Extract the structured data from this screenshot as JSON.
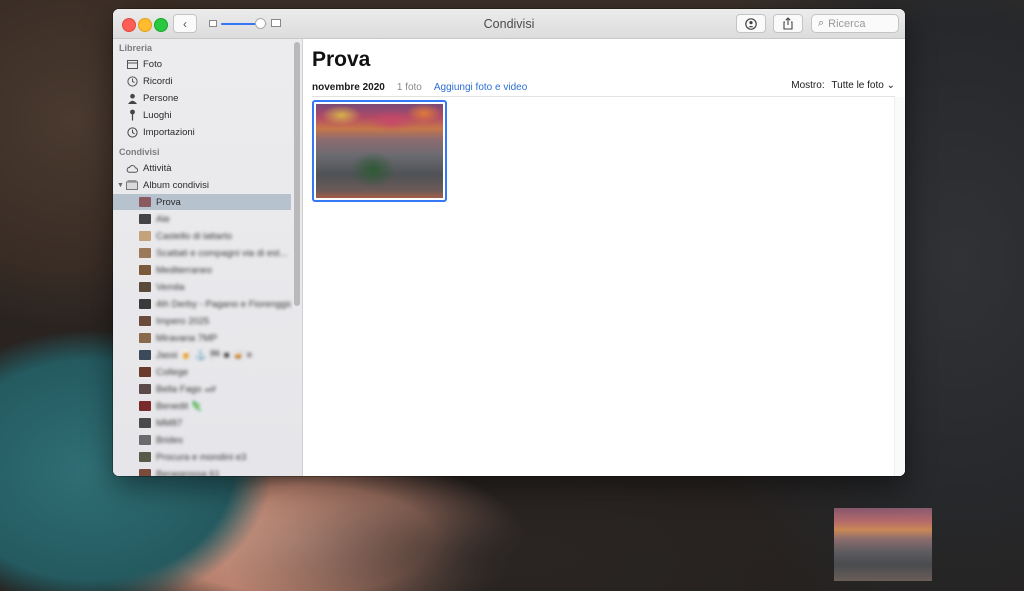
{
  "window": {
    "title": "Condivisi"
  },
  "toolbar": {
    "back_glyph": "‹",
    "people_icon": "person-circle-icon",
    "share_icon": "share-icon",
    "search_placeholder": "Ricerca",
    "zoom_level": 0.85
  },
  "sidebar": {
    "library_header": "Libreria",
    "library_items": [
      {
        "label": "Foto",
        "icon": "photos-icon"
      },
      {
        "label": "Ricordi",
        "icon": "memories-icon"
      },
      {
        "label": "Persone",
        "icon": "person-icon"
      },
      {
        "label": "Luoghi",
        "icon": "pin-icon"
      },
      {
        "label": "Importazioni",
        "icon": "clock-icon"
      }
    ],
    "shared_header": "Condivisi",
    "activity": {
      "label": "Attività",
      "icon": "cloud-icon"
    },
    "albums_group": {
      "label": "Album condivisi",
      "icon": "albums-icon"
    },
    "albums": [
      {
        "label": "Prova",
        "selected": true,
        "color": "#8a5a60"
      },
      {
        "label": "Ale",
        "blurred": true,
        "color": "#444444"
      },
      {
        "label": "Castello di lattarto",
        "blurred": true,
        "color": "#c4a27a"
      },
      {
        "label": "Scattati e compagni via di est...",
        "blurred": true,
        "color": "#9a7a5a"
      },
      {
        "label": "Mediterraneo",
        "blurred": true,
        "color": "#7a5a3a"
      },
      {
        "label": "Vemila",
        "blurred": true,
        "color": "#5a4a3a"
      },
      {
        "label": "4th Derby - Pagano e Fiorenggio",
        "blurred": true,
        "color": "#3a3a3a"
      },
      {
        "label": "Impero 2025",
        "blurred": true,
        "color": "#6a4a3a"
      },
      {
        "label": "Miravana 7MP",
        "blurred": true,
        "color": "#8a6a4a"
      },
      {
        "label": "Jassi 🍺 ⚓ 🏁 ■ 🥃 ≡",
        "blurred": true,
        "color": "#3a4a5a"
      },
      {
        "label": "College",
        "blurred": true,
        "color": "#6a3a2a"
      },
      {
        "label": "Bella Fago 🏎",
        "blurred": true,
        "color": "#5a4a4a"
      },
      {
        "label": "Benedit 🦎",
        "blurred": true,
        "color": "#7a2a2a"
      },
      {
        "label": "MM87",
        "blurred": true,
        "color": "#4a4a4a"
      },
      {
        "label": "Brides",
        "blurred": true,
        "color": "#6a6a6a"
      },
      {
        "label": "Procura e mondini e3",
        "blurred": true,
        "color": "#5a5a4a"
      },
      {
        "label": "Benegrossa 61",
        "blurred": true,
        "color": "#7a4a3a"
      }
    ]
  },
  "main": {
    "album_title": "Prova",
    "date": "novembre 2020",
    "count": "1 foto",
    "add_link": "Aggiungi foto e video",
    "filter_label": "Mostro:",
    "filter_value": "Tutte le foto",
    "filter_chevron": "⌄"
  },
  "colors": {
    "accent": "#3478f6",
    "link": "#2b6fd6",
    "selected_row": "#b6c2ce"
  }
}
